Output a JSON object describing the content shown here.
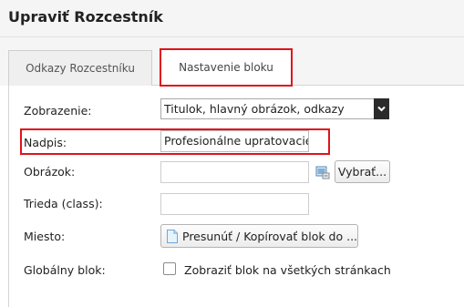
{
  "header": {
    "title": "Upraviť Rozcestník"
  },
  "tabs": [
    {
      "label": "Odkazy Rozcestníku",
      "active": false
    },
    {
      "label": "Nastavenie bloku",
      "active": true,
      "highlighted": true
    }
  ],
  "form": {
    "zobrazenie": {
      "label": "Zobrazenie:",
      "value": "Titulok, hlavný obrázok, odkazy"
    },
    "nadpis": {
      "label": "Nadpis:",
      "value": "Profesionálne upratovacie",
      "highlighted": true
    },
    "obrazok": {
      "label": "Obrázok:",
      "value": "",
      "browse_label": "Vybrať..."
    },
    "trieda": {
      "label": "Trieda (class):",
      "value": ""
    },
    "miesto": {
      "label": "Miesto:",
      "button_label": "Presunúť / Kopírovať blok do ..."
    },
    "globalny": {
      "label": "Globálny blok:",
      "checkbox_label": "Zobraziť blok na všetkých stránkach",
      "checked": false
    }
  },
  "colors": {
    "highlight": "#e0131b",
    "header_bg": "#f5f5f5",
    "select_button": "#2b2b2b"
  },
  "icons": [
    "chevron-down-icon",
    "folder-browse-icon",
    "document-icon"
  ]
}
